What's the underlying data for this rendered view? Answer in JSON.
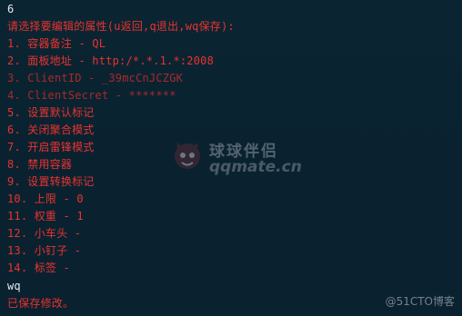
{
  "terminal": {
    "lines": [
      {
        "text": "6",
        "color": "#e8ecef"
      },
      {
        "text": "请选择要编辑的属性(u返回,q退出,wq保存):",
        "color": "#e8332f"
      },
      {
        "text": "1. 容器备注 - QL",
        "color": "#e8332f"
      },
      {
        "text": "2. 面板地址 - http:/*.*.1.*:2008",
        "color": "#e8332f"
      },
      {
        "text": "3. ClientID - _39mcCnJCZGK",
        "color": "#a92a2a"
      },
      {
        "text": "4. ClientSecret - *******",
        "color": "#a92a2a"
      },
      {
        "text": "5. 设置默认标记",
        "color": "#e8332f"
      },
      {
        "text": "6. 关闭聚合模式",
        "color": "#e8332f"
      },
      {
        "text": "7. 开启雷锋模式",
        "color": "#e8332f"
      },
      {
        "text": "8. 禁用容器",
        "color": "#e8332f"
      },
      {
        "text": "9. 设置转换标记",
        "color": "#e8332f"
      },
      {
        "text": "10. 上限 - 0",
        "color": "#e8332f"
      },
      {
        "text": "11. 权重 - 1",
        "color": "#e8332f"
      },
      {
        "text": "12. 小车头 -",
        "color": "#e8332f"
      },
      {
        "text": "13. 小钉子 -",
        "color": "#e8332f"
      },
      {
        "text": "14. 标签 -",
        "color": "#e8332f"
      },
      {
        "text": "wq",
        "color": "#e8ecef"
      },
      {
        "text": "已保存修改。",
        "color": "#e8332f"
      }
    ]
  },
  "watermark": {
    "title": "球球伴侣",
    "subtitle": "qqmate.cn",
    "logo_icon": "qqmate-logo-icon"
  },
  "corner_watermark": {
    "text": "@51CTO博客"
  }
}
